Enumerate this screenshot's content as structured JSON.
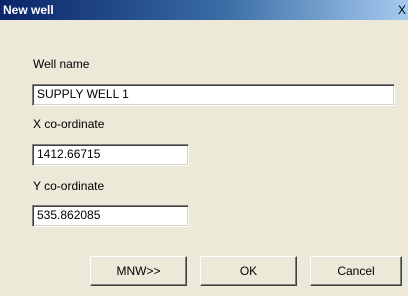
{
  "window": {
    "title": "New well",
    "close_glyph": "X"
  },
  "fields": {
    "well_name": {
      "label": "Well name",
      "value": "SUPPLY WELL 1"
    },
    "x_coordinate": {
      "label": "X co-ordinate",
      "value": "1412.66715"
    },
    "y_coordinate": {
      "label": "Y co-ordinate",
      "value": "535.862085"
    }
  },
  "buttons": {
    "mnw_label": "MNW>>",
    "ok_label": "OK",
    "cancel_label": "Cancel"
  },
  "colors": {
    "titlebar_start": "#0a246a",
    "titlebar_end": "#a6caf0",
    "dialog_background": "#ece9d8",
    "field_background": "#ffffff"
  },
  "icons": {
    "close": "close-icon"
  }
}
